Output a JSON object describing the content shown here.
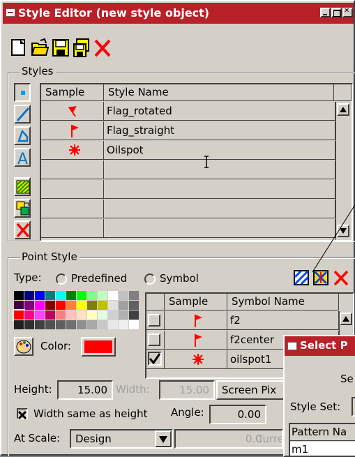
{
  "window": {
    "title": "Style Editor (new style object)"
  },
  "toolbar": {
    "icons": [
      "new-icon",
      "open-icon",
      "save-icon",
      "save-as-icon",
      "delete-icon"
    ]
  },
  "styles": {
    "legend": "Styles",
    "col_sample": "Sample",
    "col_name": "Style Name",
    "rows": [
      {
        "name": "Flag_rotated",
        "icon": "flag-rotated-icon"
      },
      {
        "name": "Flag_straight",
        "icon": "flag-straight-icon"
      },
      {
        "name": "Oilspot",
        "icon": "oilspot-icon"
      }
    ],
    "side_tools": [
      "point-tool-icon",
      "line-tool-icon",
      "polygon-tool-icon",
      "text-tool-icon",
      "pattern-icon",
      "copy-style-icon",
      "delete-style-icon"
    ]
  },
  "point_style": {
    "legend": "Point Style",
    "type_label": "Type:",
    "predefined_label": "Predefined",
    "symbol_label": "Symbol",
    "color_label": "Color:",
    "color_value": "#ff0000",
    "height_label": "Height:",
    "height_value": "15.00",
    "width_label": "Width:",
    "width_value": "15.00",
    "units_value": "Screen Pix",
    "width_same_label": "Width same as height",
    "width_same_checked": true,
    "angle_label": "Angle:",
    "angle_value": "0.00",
    "at_scale_label": "At Scale:",
    "at_scale_value": "Design",
    "scale_value": "0.0",
    "current_label": "Curre",
    "symbol_table": {
      "col_sample": "Sample",
      "col_name": "Symbol Name",
      "rows": [
        {
          "name": "f2",
          "checked": false,
          "icon": "flag-icon"
        },
        {
          "name": "f2center",
          "checked": false,
          "icon": "flag-icon"
        },
        {
          "name": "oilspot1",
          "checked": true,
          "icon": "oilspot-icon"
        }
      ]
    }
  },
  "popup": {
    "title": "Select P",
    "se_text": "Se",
    "style_set_label": "Style Set:",
    "col_name": "Pattern Na",
    "row1": "m1"
  }
}
